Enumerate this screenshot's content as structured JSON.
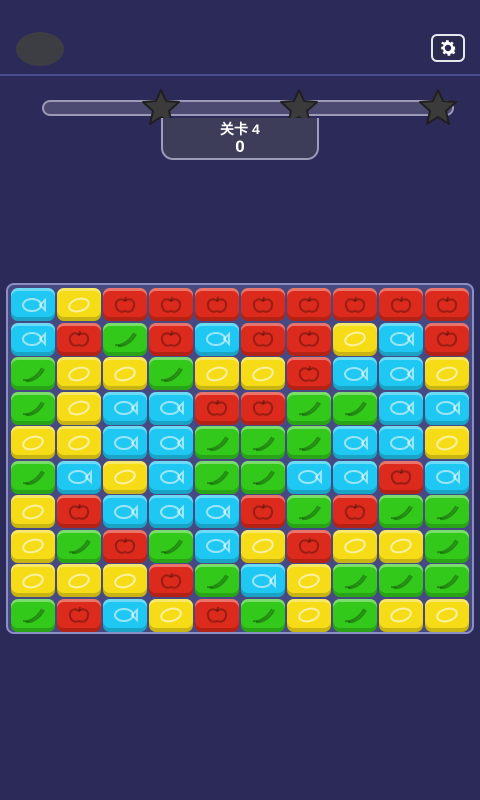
{
  "header": {
    "avatar_icon": "avatar-placeholder",
    "settings_icon": "gear-icon"
  },
  "progress": {
    "fill_fraction": 0,
    "stars": 3,
    "star_icon": "star-icon"
  },
  "level": {
    "label": "关卡 4",
    "score": "0"
  },
  "colors": {
    "background": "#2c2a58",
    "board": "#474a82",
    "blue": "#1fc8f2",
    "yellow": "#f5dc16",
    "red": "#dc2a1c",
    "green": "#33c91b"
  },
  "tile_icons": {
    "blue": "fish-icon",
    "yellow": "lemon-icon",
    "red": "apple-icon",
    "green": "pepper-icon"
  },
  "board": {
    "rows": 10,
    "cols": 10,
    "grid": [
      [
        "blue",
        "yellow",
        "red",
        "red",
        "red",
        "red",
        "red",
        "red",
        "red",
        "red"
      ],
      [
        "blue",
        "red",
        "green",
        "red",
        "blue",
        "red",
        "red",
        "yellow",
        "blue",
        "red"
      ],
      [
        "green",
        "yellow",
        "yellow",
        "green",
        "yellow",
        "yellow",
        "red",
        "blue",
        "blue",
        "yellow"
      ],
      [
        "green",
        "yellow",
        "blue",
        "blue",
        "red",
        "red",
        "green",
        "green",
        "blue",
        "blue"
      ],
      [
        "yellow",
        "yellow",
        "blue",
        "blue",
        "green",
        "green",
        "green",
        "blue",
        "blue",
        "yellow"
      ],
      [
        "green",
        "blue",
        "yellow",
        "blue",
        "green",
        "green",
        "blue",
        "blue",
        "red",
        "blue"
      ],
      [
        "yellow",
        "red",
        "blue",
        "blue",
        "blue",
        "red",
        "green",
        "red",
        "green",
        "green"
      ],
      [
        "yellow",
        "green",
        "red",
        "green",
        "blue",
        "yellow",
        "red",
        "yellow",
        "yellow",
        "green"
      ],
      [
        "yellow",
        "yellow",
        "yellow",
        "red",
        "green",
        "blue",
        "yellow",
        "green",
        "green",
        "green"
      ],
      [
        "green",
        "red",
        "blue",
        "yellow",
        "red",
        "green",
        "yellow",
        "green",
        "yellow",
        "yellow"
      ]
    ]
  }
}
